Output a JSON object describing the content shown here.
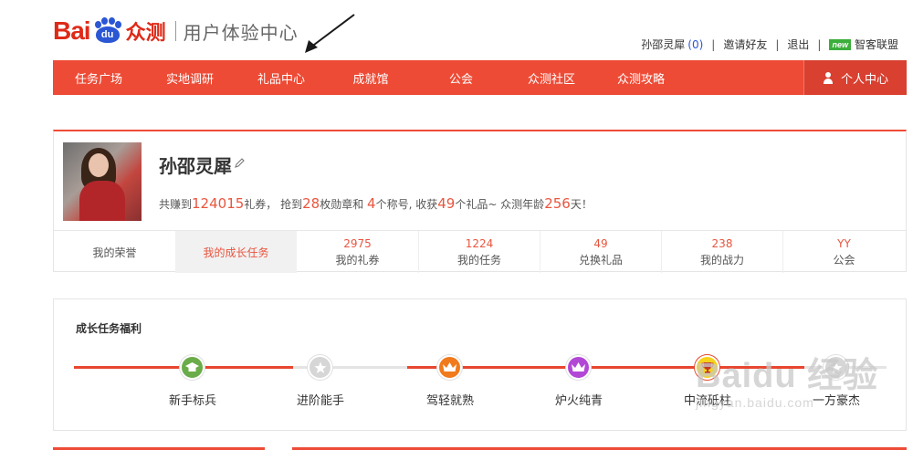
{
  "brand": {
    "logo_text": "Bai",
    "logo_paw_text": "du",
    "logo_product": "众测",
    "subtitle": "用户体验中心"
  },
  "top_links": {
    "username": "孙邵灵犀",
    "message_count": "(0)",
    "invite": "邀请好友",
    "logout": "退出",
    "new_badge": "new",
    "alliance": "智客联盟"
  },
  "nav": {
    "items": [
      "任务广场",
      "实地调研",
      "礼品中心",
      "成就馆",
      "公会",
      "众测社区",
      "众测攻略"
    ],
    "user_center": "个人中心"
  },
  "profile": {
    "name": "孙邵灵犀",
    "desc": {
      "p1": "共赚到",
      "coupons": "124015",
      "p2": "礼券， 抢到",
      "medals": "28",
      "p3": "枚勋章和 ",
      "titles": "4",
      "p4": "个称号, 收获",
      "gifts": "49",
      "p5": "个礼品~ 众测年龄",
      "age": "256",
      "p6": "天！"
    },
    "stats": [
      {
        "label": "我的荣誉"
      },
      {
        "label": "我的成长任务"
      },
      {
        "value": "2975",
        "label": "我的礼券"
      },
      {
        "value": "1224",
        "label": "我的任务"
      },
      {
        "value": "49",
        "label": "兑换礼品"
      },
      {
        "value": "238",
        "label": "我的战力"
      },
      {
        "value": "YY",
        "label": "公会"
      }
    ]
  },
  "growth": {
    "title": "成长任务福利",
    "levels": [
      {
        "label": "新手标兵",
        "icon": "graduation-cap-icon",
        "color": "#6aac4a",
        "achieved": true
      },
      {
        "label": "进阶能手",
        "icon": "star-icon",
        "color": "#d6d6d6",
        "achieved": false
      },
      {
        "label": "驾轻就熟",
        "icon": "crown-icon",
        "color": "#f07a1c",
        "achieved": true
      },
      {
        "label": "炉火纯青",
        "icon": "crown-icon",
        "color": "#b247d6",
        "achieved": true
      },
      {
        "label": "中流砥柱",
        "icon": "trophy-icon",
        "color": "#e8462f",
        "achieved": true
      },
      {
        "label": "一方豪杰",
        "icon": "star-icon",
        "color": "#d6d6d6",
        "achieved": false
      }
    ]
  },
  "watermark": {
    "big": "Baidu 经验",
    "small": "jingyan.baidu.com"
  }
}
